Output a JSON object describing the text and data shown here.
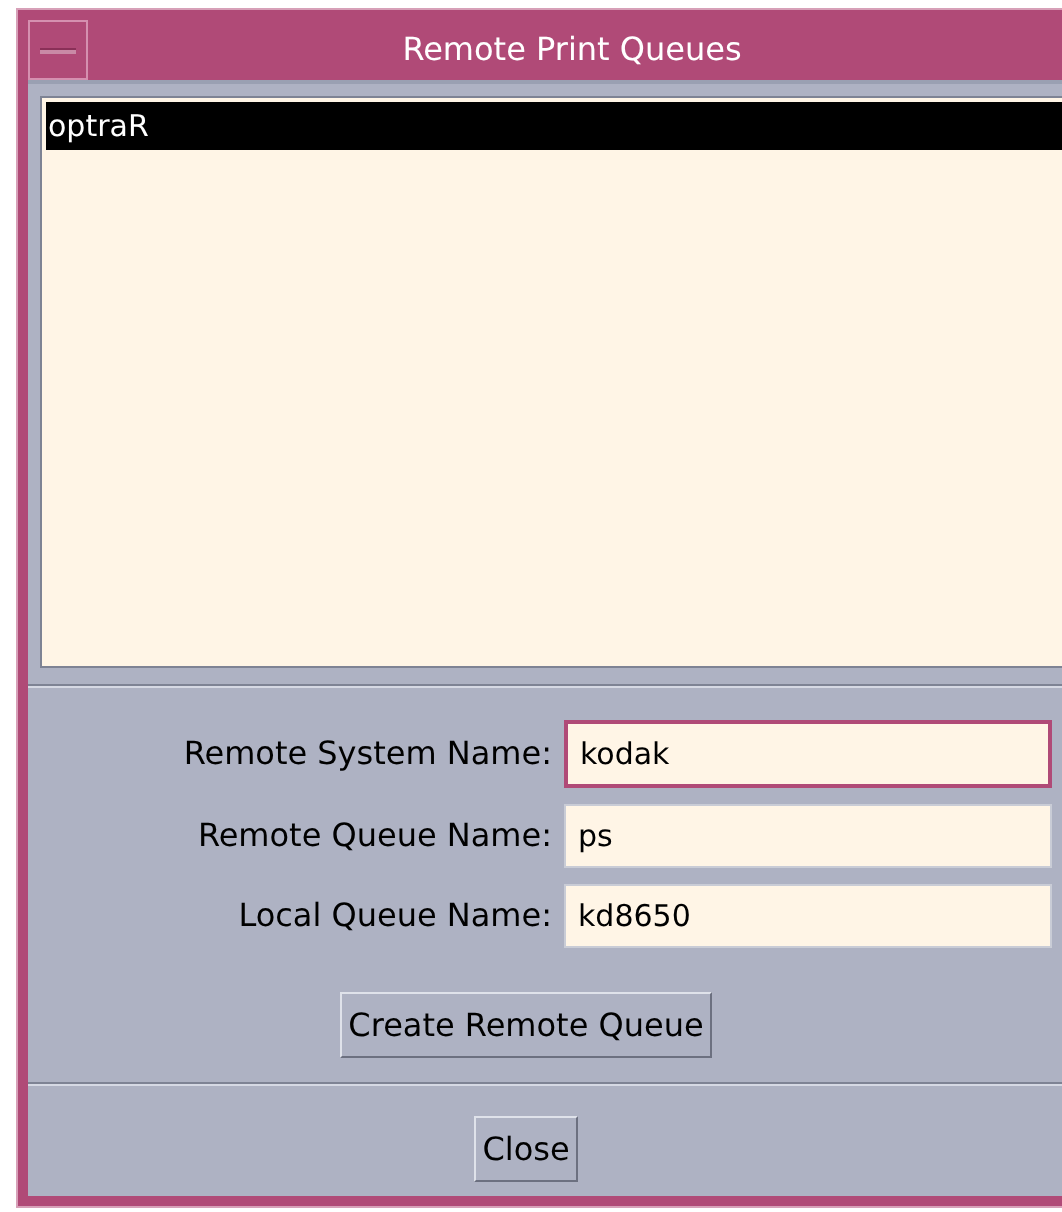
{
  "window": {
    "title": "Remote Print Queues"
  },
  "queue_list": {
    "items": [
      {
        "label": "optraR",
        "selected": true
      }
    ]
  },
  "fields": [
    {
      "label": "Remote System Name:",
      "value": "kodak",
      "focused": true
    },
    {
      "label": "Remote Queue Name:",
      "value": "ps",
      "focused": false
    },
    {
      "label": "Local Queue Name:",
      "value": "kd8650",
      "focused": false
    }
  ],
  "create_button": {
    "label": "Create Remote Queue"
  },
  "close_button": {
    "label": "Close"
  }
}
